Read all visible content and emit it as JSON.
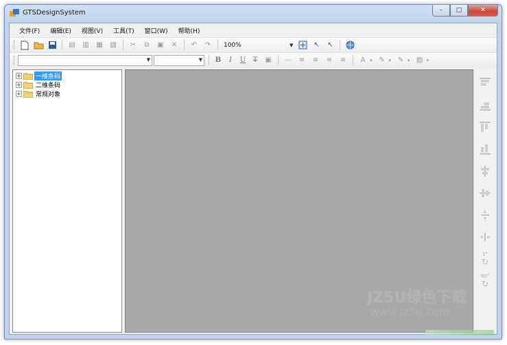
{
  "window": {
    "title": "GTSDesignSystem"
  },
  "window_controls": {
    "minimize": "–",
    "maximize": "□",
    "close": "✕"
  },
  "menu": [
    "文件(F)",
    "编辑(E)",
    "视图(V)",
    "工具(T)",
    "窗口(W)",
    "帮助(H)"
  ],
  "toolbar": {
    "zoom_value": "100%"
  },
  "format_buttons": {
    "bold": "B",
    "italic": "I",
    "underline": "U",
    "strike": "T"
  },
  "tree": {
    "items": [
      {
        "label": "一维条码",
        "selected": true
      },
      {
        "label": "二维条码",
        "selected": false
      },
      {
        "label": "常规对象",
        "selected": false
      }
    ]
  },
  "side_toolbar": {
    "rotate_90": "90°",
    "rotate_1": "1°"
  },
  "watermark": {
    "line1": "JZ5U绿色下载",
    "line2": "www.jz5u.com"
  },
  "colors": {
    "accent": "#3399ff",
    "canvas": "#a9a9a9",
    "titlebar": "#bfd4ec"
  }
}
